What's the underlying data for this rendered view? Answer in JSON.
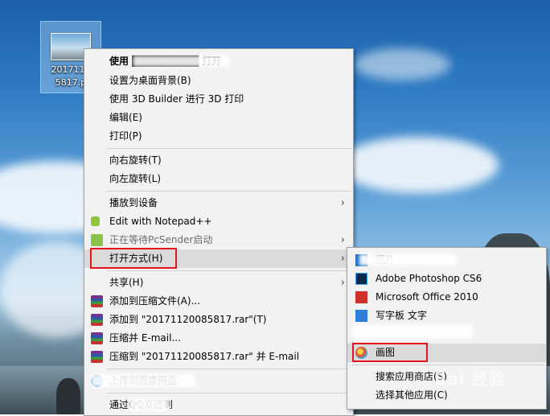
{
  "desktop_icon": {
    "label": "2017112\n5817.p"
  },
  "main_menu": {
    "items": [
      {
        "label": "使用 █████████ 打开",
        "bold": true
      },
      {
        "label": "设置为桌面背景(B)"
      },
      {
        "label": "使用 3D Builder 进行 3D 打印"
      },
      {
        "label": "编辑(E)"
      },
      {
        "label": "打印(P)"
      },
      {
        "label": "向右旋转(T)"
      },
      {
        "label": "向左旋转(L)"
      },
      {
        "label": "播放到设备"
      },
      {
        "label": "Edit with Notepad++"
      },
      {
        "label": "正在等待PcSender启动"
      },
      {
        "label": "打开方式(H)"
      },
      {
        "label": "共享(H)"
      },
      {
        "label": "添加到压缩文件(A)..."
      },
      {
        "label": "添加到 \"20171120085817.rar\"(T)"
      },
      {
        "label": "压缩并 E-mail..."
      },
      {
        "label": "压缩到 \"20171120085817.rar\" 并 E-mail"
      },
      {
        "label": "上传到百度网盘"
      },
      {
        "label": "通过QQ发送到"
      }
    ],
    "arrow": "›"
  },
  "open_with_submenu": {
    "items": [
      {
        "label": "照片"
      },
      {
        "label": "Adobe Photoshop CS6"
      },
      {
        "label": "Microsoft Office 2010"
      },
      {
        "label": "写字板 文字"
      },
      {
        "label": "画图"
      },
      {
        "label": "搜索应用商店(S)"
      },
      {
        "label": "选择其他应用(C)"
      }
    ]
  },
  "watermark": "Bai 经验",
  "colors": {
    "highlight_box": "#e0141e",
    "menu_bg": "#f2f2f2",
    "hover": "#dadada"
  },
  "icons": {
    "rar": "winrar-icon",
    "notepad": "notepad-plus-icon",
    "pcsender": "pcsender-icon",
    "photoshop": "photoshop-icon",
    "office": "office-icon",
    "paint": "paint-icon"
  }
}
